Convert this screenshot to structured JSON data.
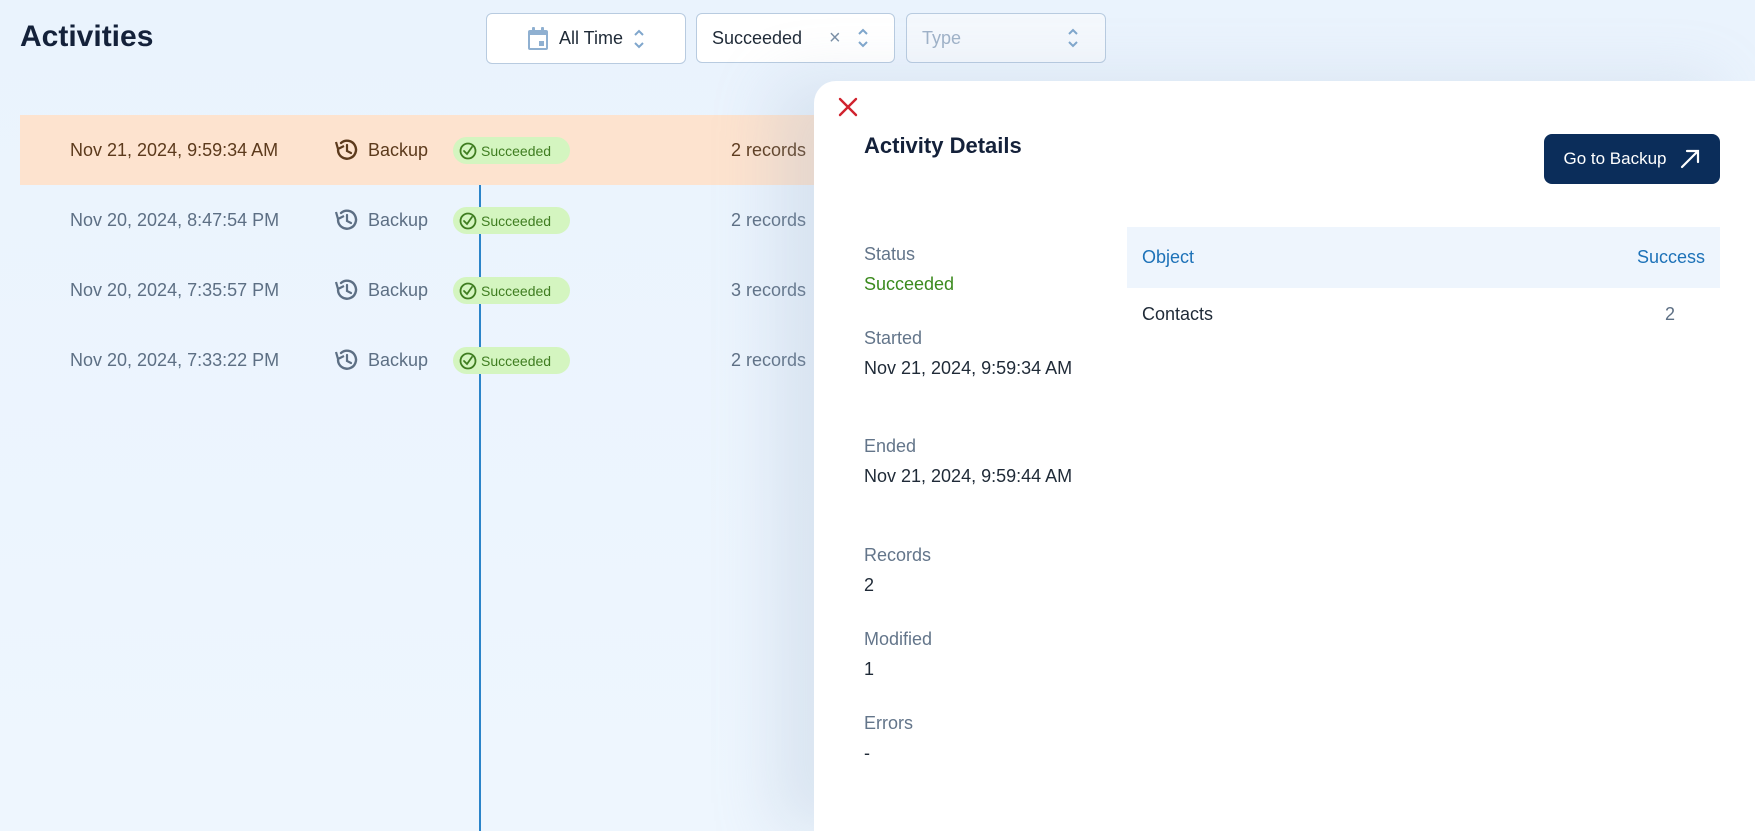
{
  "header": {
    "title": "Activities"
  },
  "filters": {
    "time": {
      "label": "All Time"
    },
    "status": {
      "value": "Succeeded",
      "clear": "×"
    },
    "type": {
      "placeholder": "Type"
    }
  },
  "activities": [
    {
      "date": "Nov 21, 2024, 9:59:34 AM",
      "type": "Backup",
      "status": "Succeeded",
      "records": "2 records"
    },
    {
      "date": "Nov 20, 2024, 8:47:54 PM",
      "type": "Backup",
      "status": "Succeeded",
      "records": "2 records"
    },
    {
      "date": "Nov 20, 2024, 7:35:57 PM",
      "type": "Backup",
      "status": "Succeeded",
      "records": "3 records"
    },
    {
      "date": "Nov 20, 2024, 7:33:22 PM",
      "type": "Backup",
      "status": "Succeeded",
      "records": "2 records"
    }
  ],
  "details": {
    "title": "Activity Details",
    "go_button": "Go to Backup",
    "status_label": "Status",
    "status_value": "Succeeded",
    "started_label": "Started",
    "started_value": "Nov 21, 2024, 9:59:34 AM",
    "ended_label": "Ended",
    "ended_value": "Nov 21, 2024, 9:59:44 AM",
    "records_label": "Records",
    "records_value": "2",
    "modified_label": "Modified",
    "modified_value": "1",
    "errors_label": "Errors",
    "errors_value": "-",
    "table": {
      "col_object": "Object",
      "col_success": "Success",
      "rows": [
        {
          "object": "Contacts",
          "success": "2"
        }
      ]
    }
  },
  "colors": {
    "accent": "#0b2d5a",
    "success": "#3b8a1e",
    "selected_row": "#fde3cf",
    "close": "#d0222e",
    "timeline": "#2b84c9"
  }
}
